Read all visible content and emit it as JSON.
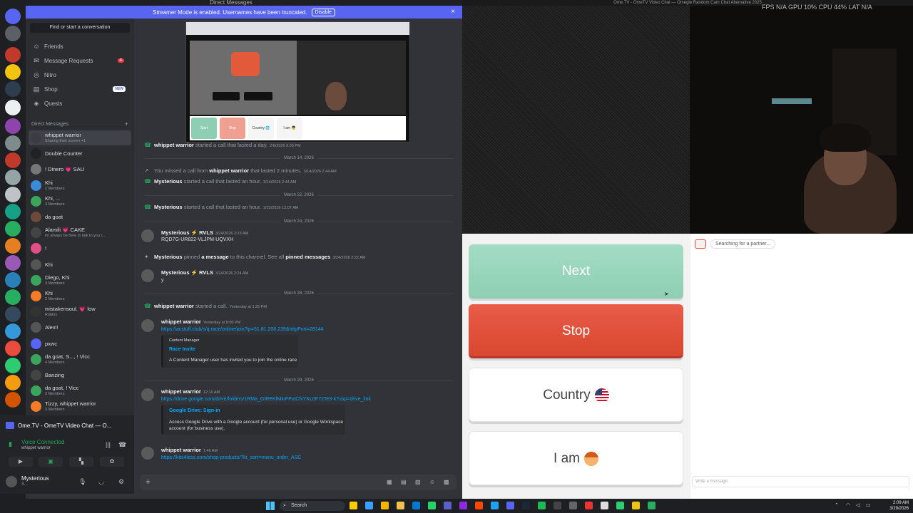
{
  "discord": {
    "window_title": "Direct Messages",
    "banner": {
      "text": "Streamer Mode is enabled. Usernames have been truncated.",
      "button": "Disable",
      "close": "×"
    },
    "search": "Find or start a conversation",
    "nav": [
      {
        "label": "Friends",
        "icon": "friends-icon"
      },
      {
        "label": "Message Requests",
        "icon": "inbox-icon",
        "badge": "4"
      },
      {
        "label": "Nitro",
        "icon": "nitro-icon"
      },
      {
        "label": "Shop",
        "icon": "shop-icon",
        "tag": "NEW"
      },
      {
        "label": "Quests",
        "icon": "quests-icon"
      }
    ],
    "dm_header": "Direct Messages",
    "dms": [
      {
        "name": "whippet warrior",
        "sub": "Sharing their screen +1",
        "color": "#3a3c43"
      },
      {
        "name": "Double Counter",
        "sub": "",
        "color": "#202225"
      },
      {
        "name": "! Dinero 💗 SAU",
        "sub": "",
        "color": "#777"
      },
      {
        "name": "Khi",
        "sub": "2 Members",
        "color": "#3b8bd9"
      },
      {
        "name": "Khi, ...",
        "sub": "3 Members",
        "color": "#3ba55d"
      },
      {
        "name": "da goat",
        "sub": "",
        "color": "#6b4a3a"
      },
      {
        "name": "Alamili 💗 CAKE",
        "sub": "im always be here to talk to you i...",
        "color": "#444"
      },
      {
        "name": "!",
        "sub": "",
        "color": "#e04f86"
      },
      {
        "name": "Khi",
        "sub": "",
        "color": "#555"
      },
      {
        "name": "Diego, Khi",
        "sub": "3 Members",
        "color": "#3ba55d"
      },
      {
        "name": "Khi",
        "sub": "2 Members",
        "color": "#f47b28"
      },
      {
        "name": "mistakensoul. 💗 low",
        "sub": "Roblox",
        "color": "#333"
      },
      {
        "name": "Alex!!",
        "sub": "",
        "color": "#555"
      },
      {
        "name": "pxwc",
        "sub": "",
        "color": "#5865f2"
      },
      {
        "name": "da goat, S..., ! Vicc",
        "sub": "4 Members",
        "color": "#3ba55d"
      },
      {
        "name": "Banzing",
        "sub": "",
        "color": "#444"
      },
      {
        "name": "da goat, ! Vicc",
        "sub": "3 Members",
        "color": "#3ba55d"
      },
      {
        "name": "Tizzy, whippet warrior",
        "sub": "3 Members",
        "color": "#f47b28"
      }
    ],
    "voice": {
      "activity": "Ome.TV - OmeTV Video Chat — O...",
      "status": "Voice Connected",
      "channel": "whippet warrior"
    },
    "user": {
      "name": "Mysterious",
      "sub": "S..."
    },
    "stream_preview": {
      "buttons": [
        "Start",
        "Stop",
        "Country 🌐",
        "I am 👦"
      ]
    },
    "messages": {
      "m1": {
        "author": "whippet warrior",
        "text": "started a call that lasted a day.",
        "ts": "2/6/2026 9:05 PM"
      },
      "d1": "March 14, 2026",
      "m2": {
        "pre": "You missed a call from ",
        "author": "whippet warrior",
        "text": " that lasted 2 minutes.",
        "ts": "3/14/2026 2:44 AM"
      },
      "m3": {
        "author": "Mysterious",
        "text": "started a call that lasted an hour.",
        "ts": "3/14/2026 2:44 AM"
      },
      "d2": "March 22, 2026",
      "m4": {
        "author": "Mysterious",
        "text": "started a call that lasted an hour.",
        "ts": "3/22/2026 12:07 AM"
      },
      "d3": "March 24, 2026",
      "m5": {
        "author": "Mysterious ⚡ RVLS",
        "ts": "3/24/2026 2:23 AM",
        "body": "RQD7G-UR822-VLJPM-UQVXH"
      },
      "m6": {
        "author": "Mysterious",
        "text": "pinned",
        "text2": " a message ",
        "text3": "to this channel. See all ",
        "text4": "pinned messages",
        "ts": "3/24/2026 2:22 AM"
      },
      "m7": {
        "author": "Mysterious ⚡ RVLS",
        "ts": "3/24/2026 2:24 AM",
        "body": "y"
      },
      "d4": "March 28, 2026",
      "m8": {
        "author": "whippet warrior",
        "text": "started a call.",
        "ts": "Yesterday at 1:25 PM"
      },
      "m9": {
        "author": "whippet warrior",
        "ts": "Yesterday at 8:00 PM",
        "link": "https://acstuff.club/s/q:race/online/join?ip=51.81.208.239&httpPort=28144",
        "embed": {
          "provider": "Content Manager",
          "title": "Race Invite",
          "desc": "A Content Manager user has invited you to join the online race"
        }
      },
      "d5": "March 29, 2026",
      "m10": {
        "author": "whippet warrior",
        "ts": "12:16 AM",
        "link": "https://drive.google.com/drive/folders/1RMa_GtREKfMinFPxtCfvYKL0F72Te3-k?usp=drive_link",
        "embed": {
          "title": "Google Drive: Sign-in",
          "desc": "Access Google Drive with a Google account (for personal use) or Google Workspace account (for business use)."
        }
      },
      "m11": {
        "author": "whippet warrior",
        "ts": "1:46 AM",
        "link": "https://kits4less.com/shop-products/?kt_sort=menu_order_ASC"
      }
    }
  },
  "ome": {
    "window_title": "Ome.TV - OmeTV Video Chat — Omegle Random Cam Chat Alternative 2025",
    "hud": "FPS N/A   GPU 10%   CPU 44%   LAT N/A",
    "buttons": {
      "next": "Next",
      "stop": "Stop",
      "country": "Country",
      "iam": "I am"
    },
    "status": "Searching for a partner...",
    "input_placeholder": "Write a message"
  },
  "taskbar": {
    "search": "Search",
    "time": "2:09 AM",
    "date": "3/29/2026"
  }
}
